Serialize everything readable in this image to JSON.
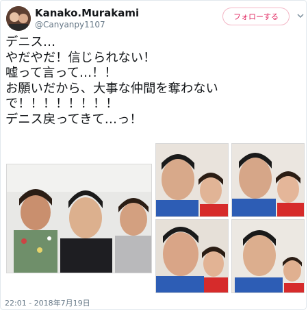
{
  "tweet": {
    "display_name": "Kanako.Murakami",
    "handle": "@Canyanpy1107",
    "follow_label": "フォローする",
    "text_lines": [
      "デニス…",
      "やだやだ！信じられない！",
      "嘘って言って…！！",
      "お願いだから、大事な仲間を奪わない",
      "で！！！！！！！！",
      "デニス戻ってきて…っ！"
    ],
    "timestamp": "22:01 - 2018年7月19日"
  },
  "icons": {
    "avatar": "user-avatar-photo",
    "more": "chevron-down-icon"
  },
  "colors": {
    "accent": "#e0245e",
    "secondary_text": "#657786",
    "border": "#e1e8ed"
  }
}
